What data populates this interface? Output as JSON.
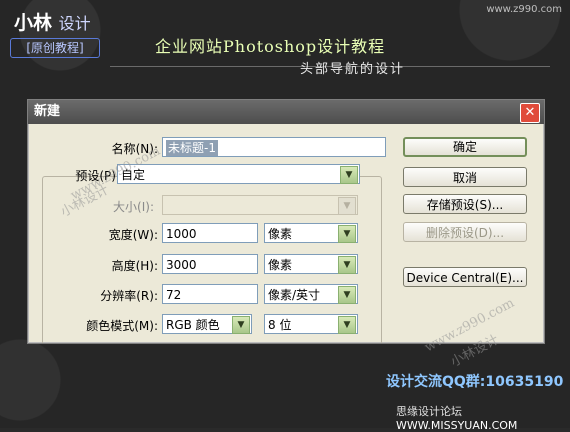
{
  "header": {
    "logo_main": "小林",
    "logo_sub": "设计",
    "logo_tag": "[原创教程]",
    "title": "企业网站Photoshop设计教程",
    "subtitle": "头部导航的设计",
    "watermark_top": "www.z990.com"
  },
  "dialog": {
    "title": "新建",
    "close_icon": "close-icon",
    "name_label": "名称(N):",
    "name_value": "未标题-1",
    "preset_label": "预设(P):",
    "preset_value": "自定",
    "size_label": "大小(I):",
    "width_label": "宽度(W):",
    "width_value": "1000",
    "width_unit": "像素",
    "height_label": "高度(H):",
    "height_value": "3000",
    "height_unit": "像素",
    "resolution_label": "分辨率(R):",
    "resolution_value": "72",
    "resolution_unit": "像素/英寸",
    "color_mode_label": "颜色模式(M):",
    "color_mode_value": "RGB 颜色",
    "bit_depth_value": "8 位",
    "buttons": {
      "ok": "确定",
      "cancel": "取消",
      "save_preset": "存储预设(S)...",
      "delete_preset": "删除预设(D)...",
      "device_central": "Device Central(E)..."
    }
  },
  "watermarks": {
    "site": "www.z990.com",
    "brand": "小林设计"
  },
  "footer": {
    "qq": "设计交流QQ群:10635190",
    "forum": "思缘设计论坛",
    "forum_site": "WWW.MISSYUAN.COM"
  }
}
